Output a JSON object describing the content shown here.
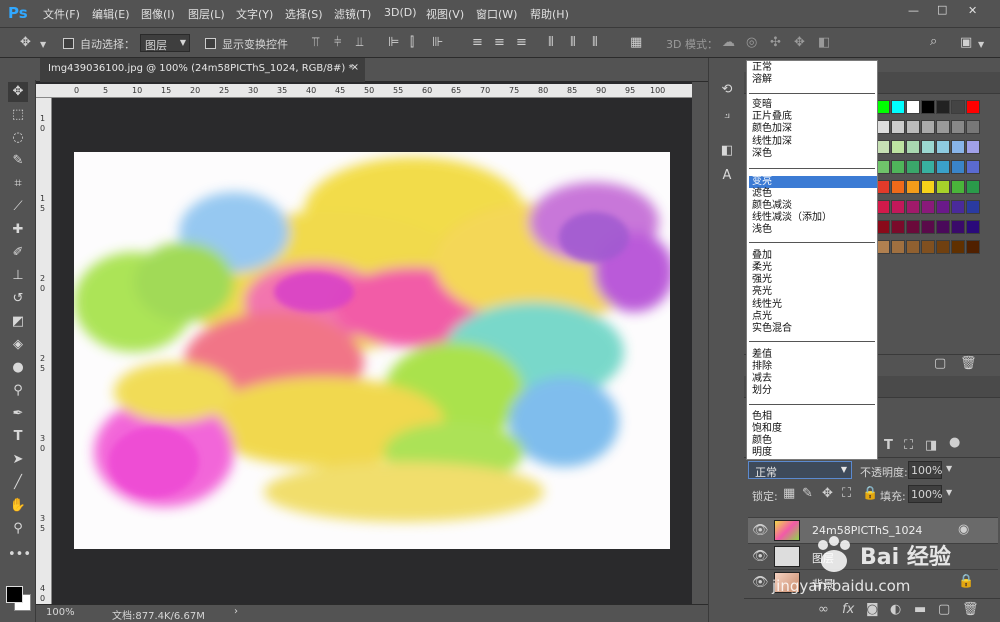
{
  "app": {
    "logo": "Ps",
    "accent": "#31a8ff"
  },
  "menubar": {
    "items": [
      "文件(F)",
      "编辑(E)",
      "图像(I)",
      "图层(L)",
      "文字(Y)",
      "选择(S)",
      "滤镜(T)",
      "3D(D)",
      "视图(V)",
      "窗口(W)",
      "帮助(H)"
    ]
  },
  "window_controls": {
    "minimize": "—",
    "restore": "□",
    "close": "✕"
  },
  "options": {
    "auto_select_label": "自动选择：",
    "auto_select_value": "图层",
    "show_transform_label": "显示变换控件",
    "mode3d_label": "3D 模式："
  },
  "document": {
    "tab_title": "Img439036100.jpg @ 100% (24m58PICThS_1024, RGB/8#) *",
    "tab_close": "×",
    "zoom": "100%",
    "doc_info": "文档:877.4K/6.67M"
  },
  "ruler": {
    "top_ticks": [
      "0",
      "5",
      "10",
      "15",
      "20",
      "25",
      "30",
      "35",
      "40",
      "45",
      "50",
      "55",
      "60",
      "65",
      "70",
      "75",
      "80",
      "85",
      "90",
      "95",
      "100"
    ],
    "left_ticks": [
      "1",
      "0",
      "1",
      "5",
      "2",
      "0",
      "2",
      "5",
      "3",
      "0",
      "3",
      "5",
      "4",
      "0"
    ]
  },
  "blend_menu": {
    "groups": [
      [
        "正常",
        "溶解"
      ],
      [
        "变暗",
        "正片叠底",
        "颜色加深",
        "线性加深",
        "深色"
      ],
      [
        "变亮",
        "滤色",
        "颜色减淡",
        "线性减淡（添加）",
        "浅色"
      ],
      [
        "叠加",
        "柔光",
        "强光",
        "亮光",
        "线性光",
        "点光",
        "实色混合"
      ],
      [
        "差值",
        "排除",
        "减去",
        "划分"
      ],
      [
        "色相",
        "饱和度",
        "颜色",
        "明度"
      ]
    ],
    "highlighted": "变亮"
  },
  "layers": {
    "blend_value": "正常",
    "opacity_label": "不透明度:",
    "opacity_value": "100%",
    "lock_label": "锁定:",
    "fill_label": "填充:",
    "fill_value": "100%",
    "rows": [
      {
        "name": "24m58PICThS_1024"
      },
      {
        "name": "图层"
      },
      {
        "name": "背景"
      }
    ]
  },
  "watermark": {
    "text": "Bai 经验",
    "url": "jingyan.baidu.com"
  }
}
